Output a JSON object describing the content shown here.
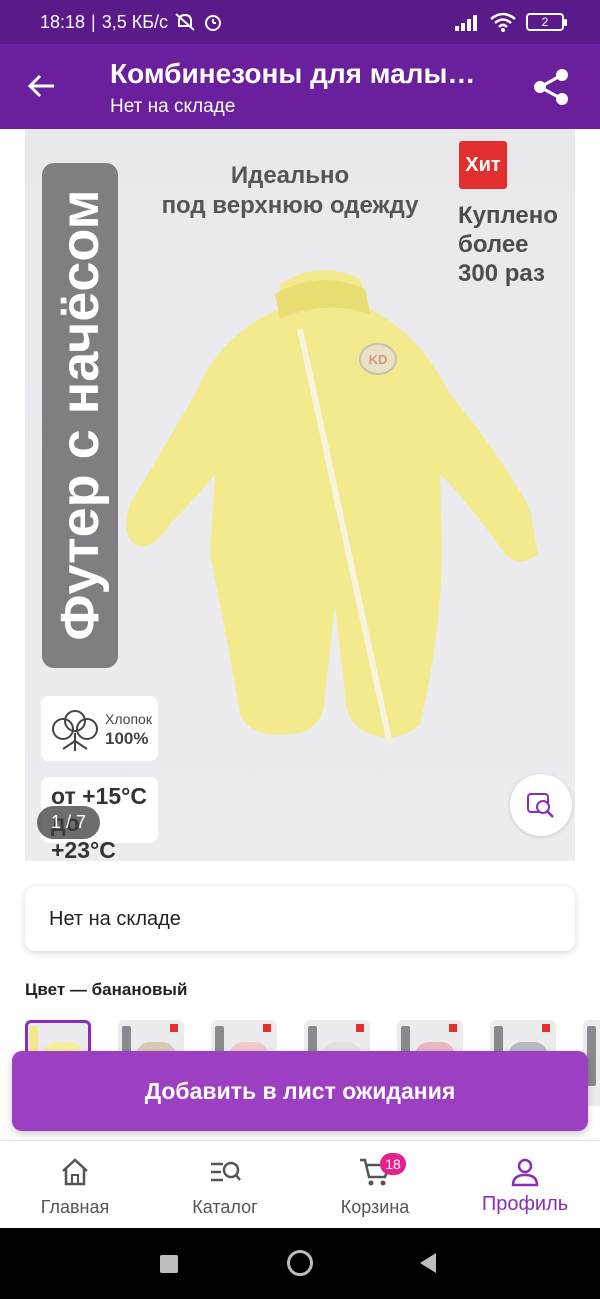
{
  "status_bar": {
    "time": "18:18",
    "network": "3,5 КБ/с",
    "battery": "2"
  },
  "app_bar": {
    "title": "Комбинезоны для малы…",
    "subtitle": "Нет на складе"
  },
  "product_image": {
    "vertical_label": "Футер с начёсом",
    "tagline_1": "Идеально",
    "tagline_2": "под верхнюю одежду",
    "hit_badge": "Хит",
    "bought_1": "Куплено",
    "bought_2": "более",
    "bought_3": "300 раз",
    "cotton_1": "Хлопок",
    "cotton_2": "100%",
    "temp_1": "от +15°C",
    "temp_2": "до +23°C",
    "logo": "KD",
    "counter": "1 / 7"
  },
  "stock": {
    "text": "Нет на складе"
  },
  "color": {
    "label": "Цвет — банановый"
  },
  "thumbnails": [
    "banana",
    "beige",
    "pink",
    "grey",
    "pink",
    "grey",
    "partial"
  ],
  "cta": {
    "label": "Добавить в лист ожидания"
  },
  "bottom_nav": [
    {
      "label": "Главная",
      "icon": "home-icon"
    },
    {
      "label": "Каталог",
      "icon": "catalog-search-icon"
    },
    {
      "label": "Корзина",
      "icon": "cart-icon",
      "badge": "18"
    },
    {
      "label": "Профиль",
      "icon": "profile-icon",
      "active": true
    }
  ],
  "colors": {
    "status_bar": "#5a1a8a",
    "app_bar": "#6a1f9c",
    "accent": "#9c3fc2",
    "badge": "#e6218b",
    "suit": "#f3ea8e"
  }
}
